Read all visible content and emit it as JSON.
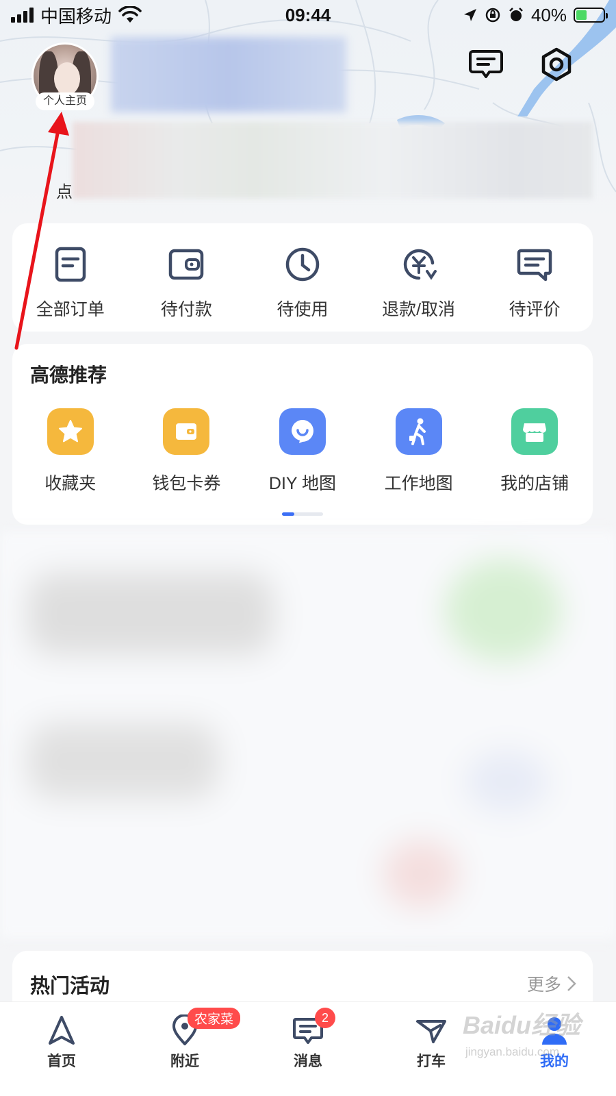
{
  "status_bar": {
    "carrier": "中国移动",
    "time": "09:44",
    "battery_pct": "40%"
  },
  "header": {
    "avatar_label": "个人主页",
    "partial_text": "点"
  },
  "orders": [
    {
      "label": "全部订单",
      "icon": "order-list-icon"
    },
    {
      "label": "待付款",
      "icon": "wallet-icon"
    },
    {
      "label": "待使用",
      "icon": "clock-icon"
    },
    {
      "label": "退款/取消",
      "icon": "refund-icon"
    },
    {
      "label": "待评价",
      "icon": "comment-icon"
    }
  ],
  "recommend": {
    "title": "高德推荐",
    "items": [
      {
        "label": "收藏夹",
        "icon": "star-icon",
        "color": "#f5b83d"
      },
      {
        "label": "钱包卡券",
        "icon": "wallet-icon",
        "color": "#f5b83d"
      },
      {
        "label": "DIY 地图",
        "icon": "smile-pin-icon",
        "color": "#5b87f6"
      },
      {
        "label": "工作地图",
        "icon": "worker-icon",
        "color": "#5b87f6"
      },
      {
        "label": "我的店铺",
        "icon": "store-icon",
        "color": "#4fcf9e"
      }
    ]
  },
  "hot": {
    "title": "热门活动",
    "more": "更多"
  },
  "tabs": [
    {
      "label": "首页",
      "icon": "navigate-icon"
    },
    {
      "label": "附近",
      "icon": "location-pin-icon",
      "tag": "农家菜"
    },
    {
      "label": "消息",
      "icon": "message-icon",
      "badge": "2"
    },
    {
      "label": "打车",
      "icon": "taxi-icon"
    },
    {
      "label": "我的",
      "icon": "user-icon",
      "active": true
    }
  ],
  "colors": {
    "accent": "#2f6cf6",
    "badge": "#ff4b4b",
    "annotation_arrow": "#e8141b"
  },
  "watermark": {
    "text": "Baidu经验",
    "sub": "jingyan.baidu.com"
  }
}
